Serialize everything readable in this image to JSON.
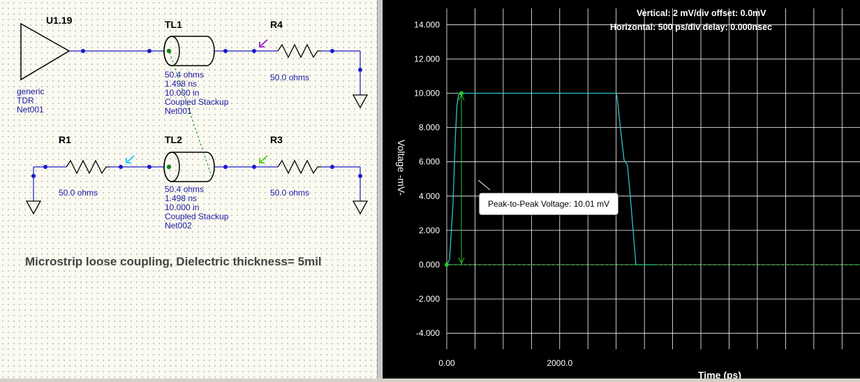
{
  "schematic": {
    "driver": {
      "ref": "U1.19",
      "lines": [
        "generic",
        "TDR",
        "Net001"
      ]
    },
    "tl1": {
      "ref": "TL1",
      "lines": [
        "50.4 ohms",
        "1.498 ns",
        "10.000 in",
        "Coupled Stackup",
        "Net001"
      ]
    },
    "tl2": {
      "ref": "TL2",
      "lines": [
        "50.4 ohms",
        "1.498 ns",
        "10.000 in",
        "Coupled Stackup",
        "Net002"
      ]
    },
    "r4": {
      "ref": "R4",
      "value": "50.0 ohms"
    },
    "r1": {
      "ref": "R1",
      "value": "50.0 ohms"
    },
    "r3": {
      "ref": "R3",
      "value": "50.0 ohms"
    },
    "caption": "Microstrip loose coupling, Dielectric thickness= 5mil",
    "colors": {
      "wire": "#1a1acc",
      "probe_r4": "#9933cc",
      "probe_r1": "#33ccff",
      "probe_r3": "#66cc33",
      "coupling": "#118811"
    }
  },
  "scope": {
    "header_vertical": "Vertical: 2 mV/div  offset: 0.0mV",
    "header_horizontal": "Horizontal: 500 ps/div  delay: 0.000nsec",
    "ylabel": "Voltage  -mV-",
    "xlabel": "Time  (ps)",
    "y_ticks": [
      "14.000",
      "12.000",
      "10.000",
      "8.000",
      "6.000",
      "4.000",
      "2.000",
      "0.000",
      "-2.000",
      "-4.000"
    ],
    "x_ticks": [
      "0.00",
      "2000.0"
    ],
    "tooltip": "Peak-to-Peak Voltage: 10.01 mV",
    "colors": {
      "trace": "#2ec4c4",
      "marker": "#22cc22",
      "grid": "#ffffff",
      "background": "#000000"
    }
  },
  "chart_data": {
    "type": "line",
    "title": "",
    "xlabel": "Time  (ps)",
    "ylabel": "Voltage  -mV-",
    "xlim": [
      0,
      3700
    ],
    "ylim": [
      -5,
      15
    ],
    "grid": true,
    "series": [
      {
        "x": [
          0,
          50,
          110,
          150,
          180,
          210,
          250,
          3000,
          3020,
          3080,
          3140,
          3200,
          3250,
          3350,
          3700
        ],
        "y": [
          0,
          0.3,
          3.5,
          7.2,
          9.3,
          9.9,
          10.0,
          10.0,
          9.7,
          7.8,
          6.1,
          5.8,
          4.0,
          0.0,
          0.0
        ]
      }
    ],
    "annotations": [
      "Peak-to-Peak Voltage: 10.01 mV"
    ]
  }
}
